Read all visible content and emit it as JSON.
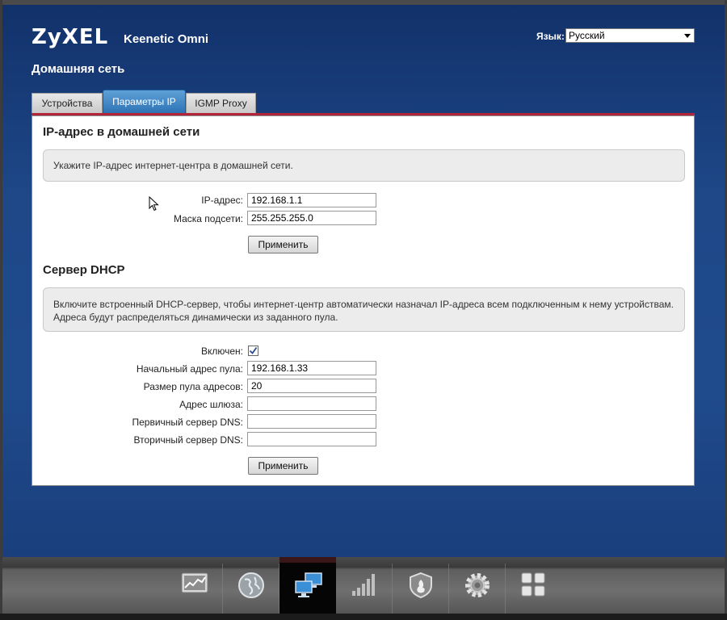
{
  "header": {
    "brand": "ZyXEL",
    "model": "Keenetic Omni",
    "language_label": "Язык:",
    "language_value": "Русский"
  },
  "page_title": "Домашняя сеть",
  "tabs": [
    {
      "label": "Устройства",
      "active": false
    },
    {
      "label": "Параметры IP",
      "active": true
    },
    {
      "label": "IGMP Proxy",
      "active": false
    }
  ],
  "ip_section": {
    "title": "IP-адрес в домашней сети",
    "info": "Укажите IP-адрес интернет-центра в домашней сети.",
    "ip_label": "IP-адрес:",
    "ip_value": "192.168.1.1",
    "mask_label": "Маска подсети:",
    "mask_value": "255.255.255.0",
    "apply_label": "Применить"
  },
  "dhcp_section": {
    "title": "Сервер DHCP",
    "info": "Включите встроенный DHCP-сервер, чтобы интернет-центр автоматически назначал IP-адреса всем подключенным к нему устройствам. Адреса будут распределяться динамически из заданного пула.",
    "enabled_label": "Включен:",
    "enabled": true,
    "pool_start_label": "Начальный адрес пула:",
    "pool_start_value": "192.168.1.33",
    "pool_size_label": "Размер пула адресов:",
    "pool_size_value": "20",
    "gateway_label": "Адрес шлюза:",
    "gateway_value": "",
    "dns1_label": "Первичный сервер DNS:",
    "dns1_value": "",
    "dns2_label": "Вторичный сервер DNS:",
    "dns2_value": "",
    "apply_label": "Применить"
  },
  "dock": [
    {
      "name": "monitor-icon",
      "active": false
    },
    {
      "name": "internet-globe-icon",
      "active": false
    },
    {
      "name": "home-network-icon",
      "active": true
    },
    {
      "name": "wifi-signal-icon",
      "active": false
    },
    {
      "name": "security-shield-icon",
      "active": false
    },
    {
      "name": "system-gear-icon",
      "active": false
    },
    {
      "name": "apps-grid-icon",
      "active": false
    }
  ],
  "colors": {
    "background": "#1e4888",
    "active_tab": "#3a80c0",
    "accent_line": "#b3263a",
    "dock_active": "#050505"
  }
}
